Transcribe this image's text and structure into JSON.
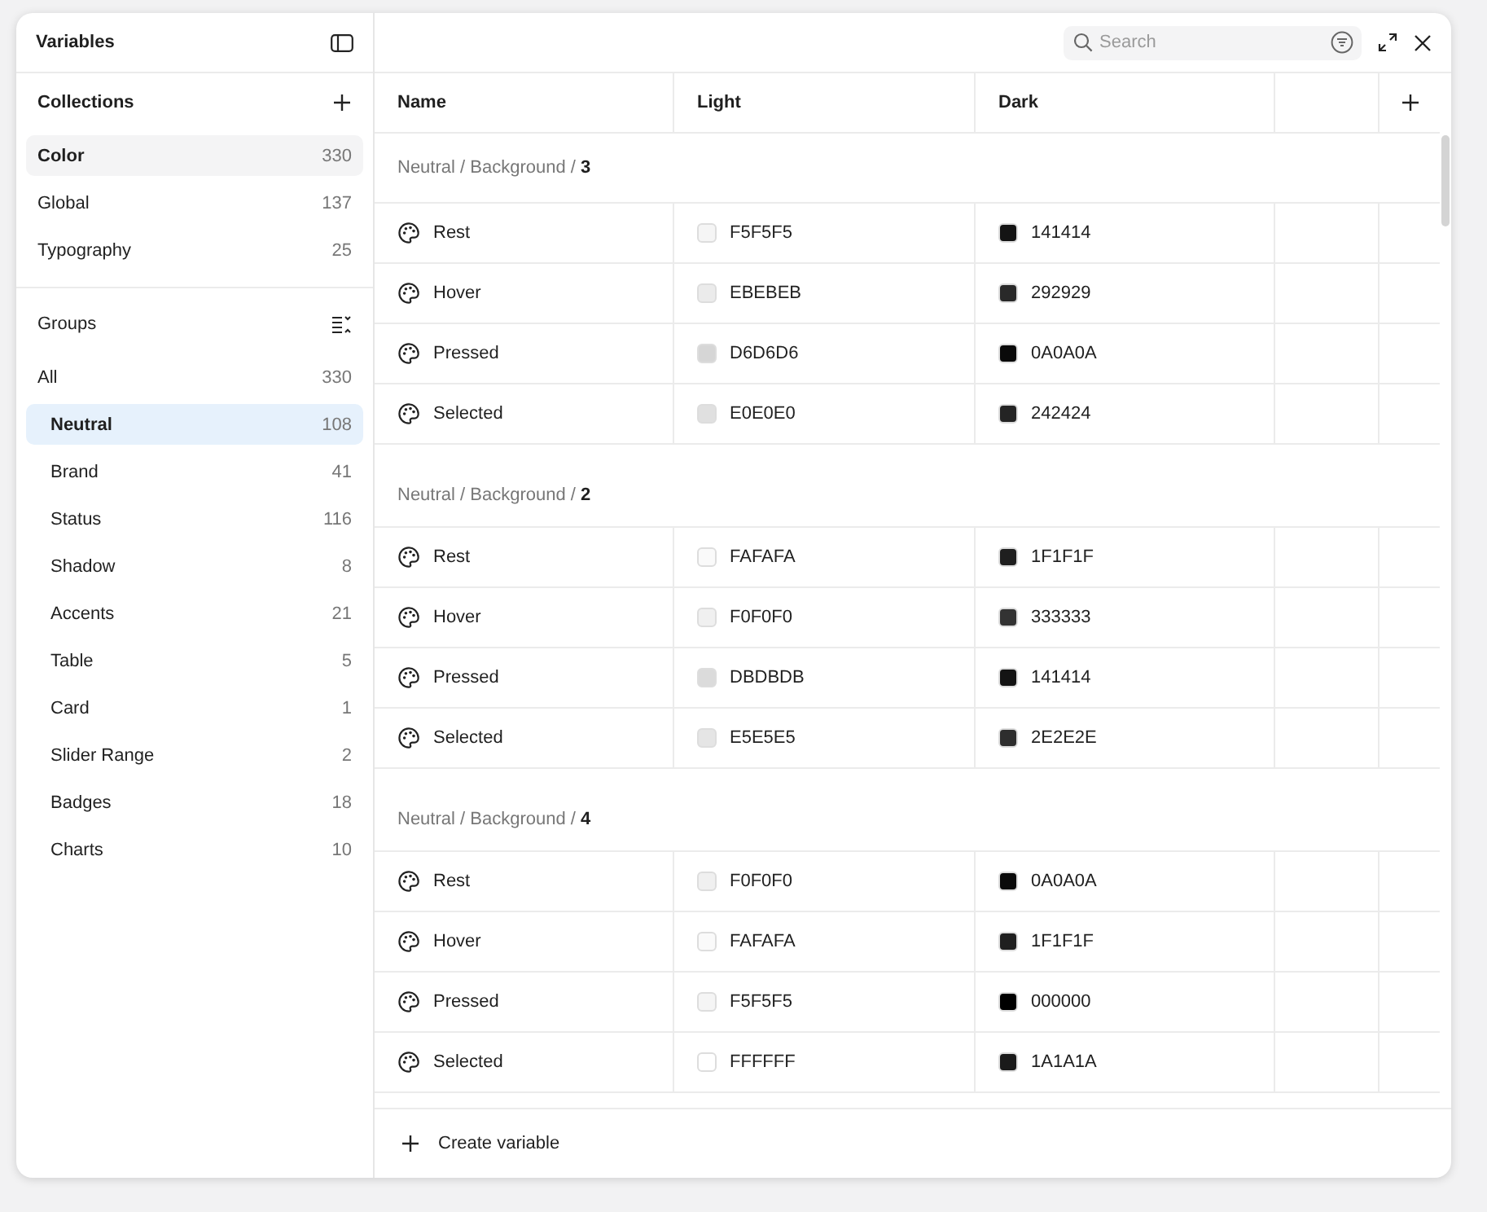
{
  "sidebar": {
    "title": "Variables",
    "collections_title": "Collections",
    "collections": [
      {
        "label": "Color",
        "count": "330",
        "selected": true
      },
      {
        "label": "Global",
        "count": "137",
        "selected": false
      },
      {
        "label": "Typography",
        "count": "25",
        "selected": false
      }
    ],
    "groups_title": "Groups",
    "groups": [
      {
        "label": "All",
        "count": "330",
        "selected": false,
        "children": [
          {
            "label": "Neutral",
            "count": "108",
            "selected": true
          },
          {
            "label": "Brand",
            "count": "41",
            "selected": false
          },
          {
            "label": "Status",
            "count": "116",
            "selected": false
          },
          {
            "label": "Shadow",
            "count": "8",
            "selected": false
          },
          {
            "label": "Accents",
            "count": "21",
            "selected": false
          },
          {
            "label": "Table",
            "count": "5",
            "selected": false
          },
          {
            "label": "Card",
            "count": "1",
            "selected": false
          },
          {
            "label": "Slider Range",
            "count": "2",
            "selected": false
          },
          {
            "label": "Badges",
            "count": "18",
            "selected": false
          },
          {
            "label": "Charts",
            "count": "10",
            "selected": false
          }
        ]
      }
    ]
  },
  "search": {
    "placeholder": "Search"
  },
  "table": {
    "columns": [
      "Name",
      "Light",
      "Dark"
    ],
    "groups": [
      {
        "title": "Neutral / Background / **3**",
        "rows": [
          {
            "name": "Rest",
            "light": "F5F5F5",
            "dark": "141414"
          },
          {
            "name": "Hover",
            "light": "EBEBEB",
            "dark": "292929"
          },
          {
            "name": "Pressed",
            "light": "D6D6D6",
            "dark": "0A0A0A"
          },
          {
            "name": "Selected",
            "light": "E0E0E0",
            "dark": "242424"
          }
        ]
      },
      {
        "title": "Neutral / Background / **2**",
        "rows": [
          {
            "name": "Rest",
            "light": "FAFAFA",
            "dark": "1F1F1F"
          },
          {
            "name": "Hover",
            "light": "F0F0F0",
            "dark": "333333"
          },
          {
            "name": "Pressed",
            "light": "DBDBDB",
            "dark": "141414"
          },
          {
            "name": "Selected",
            "light": "E5E5E5",
            "dark": "2E2E2E"
          }
        ]
      },
      {
        "title": "Neutral / Background / **4**",
        "rows": [
          {
            "name": "Rest",
            "light": "F0F0F0",
            "dark": "0A0A0A"
          },
          {
            "name": "Hover",
            "light": "FAFAFA",
            "dark": "1F1F1F"
          },
          {
            "name": "Pressed",
            "light": "F5F5F5",
            "dark": "000000"
          },
          {
            "name": "Selected",
            "light": "FFFFFF",
            "dark": "1A1A1A"
          }
        ]
      }
    ]
  },
  "footer": {
    "label": "Create variable"
  }
}
